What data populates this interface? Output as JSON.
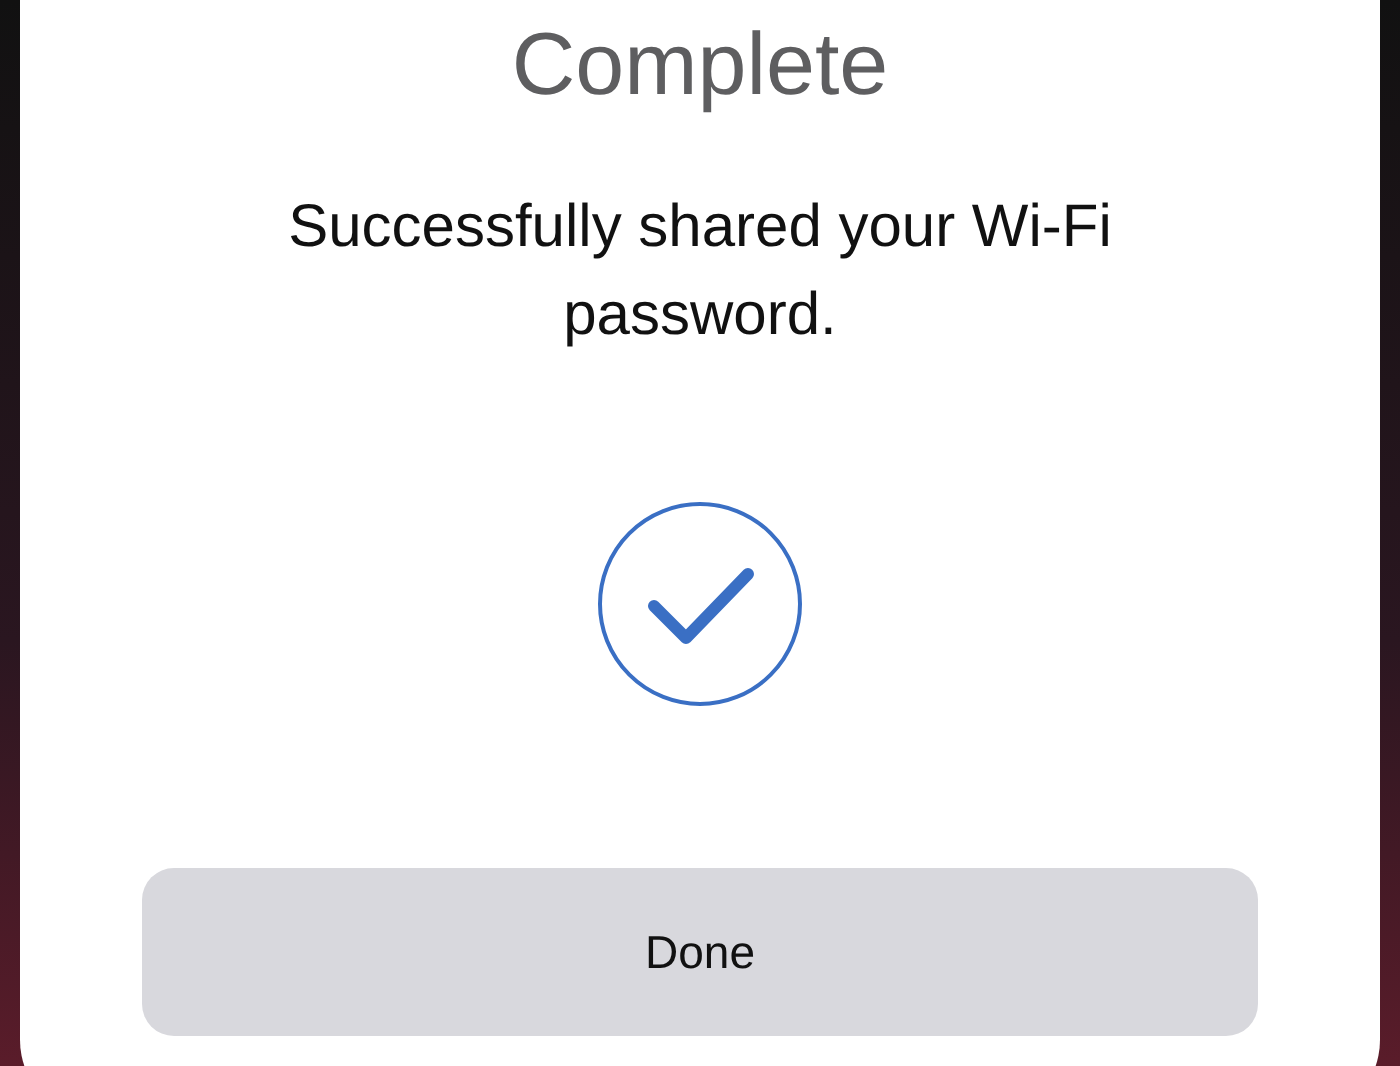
{
  "dialog": {
    "title": "Complete",
    "message": "Successfully shared your Wi-Fi password.",
    "button": "Done"
  }
}
